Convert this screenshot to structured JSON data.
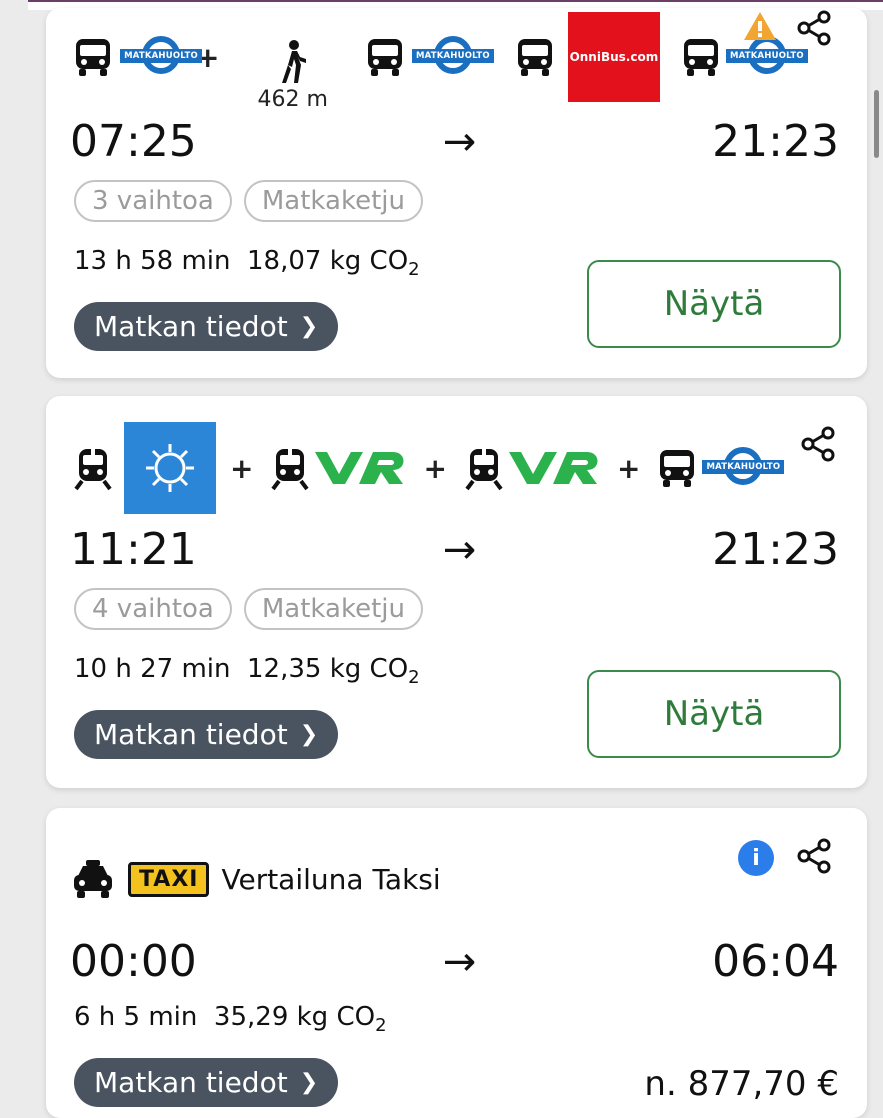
{
  "colors": {
    "accent_green": "#2e7b3c",
    "matkahuolto_blue": "#1a6fc0",
    "onnibus_red": "#e3111b",
    "vr_green": "#2bb24c",
    "warning": "#f2a531",
    "info_blue": "#2b7de9",
    "taxi_yellow": "#f4c21f"
  },
  "journeys": [
    {
      "icons": [
        "bus-icon",
        "matkahuolto-logo",
        "walk-icon",
        "bus-icon",
        "matkahuolto-logo",
        "bus-icon",
        "onnibus-logo",
        "bus-icon",
        "matkahuolto-logo",
        "warning-icon",
        "share-icon"
      ],
      "logo_text": "MATKAHUOLTO",
      "onnibus_text": "OnniBus.com",
      "walk_distance": "462 m",
      "departure": "07:25",
      "arrow": "→",
      "arrival": "21:23",
      "chips": [
        "3 vaihtoa",
        "Matkaketju"
      ],
      "duration": "13 h 58 min",
      "co2": "18,07 kg CO",
      "co2_sub": "2",
      "details_label": "Matkan tiedot",
      "show_label": "Näytä"
    },
    {
      "icons": [
        "train-icon",
        "weather-logo",
        "train-icon",
        "vr-logo",
        "train-icon",
        "vr-logo",
        "bus-icon",
        "matkahuolto-logo",
        "share-icon"
      ],
      "logo_text": "MATKAHUOLTO",
      "plus": "+",
      "departure": "11:21",
      "arrow": "→",
      "arrival": "21:23",
      "chips": [
        "4 vaihtoa",
        "Matkaketju"
      ],
      "duration": "10 h 27 min",
      "co2": "12,35 kg CO",
      "co2_sub": "2",
      "details_label": "Matkan tiedot",
      "show_label": "Näytä"
    },
    {
      "icons": [
        "taxi-car-icon",
        "info-icon",
        "share-icon"
      ],
      "taxi_badge": "TAXI",
      "label": "Vertailuna Taksi",
      "info_glyph": "i",
      "departure": "00:00",
      "arrow": "→",
      "arrival": "06:04",
      "duration": "6 h 5 min",
      "co2": "35,29 kg CO",
      "co2_sub": "2",
      "details_label": "Matkan tiedot",
      "price": "n. 877,70 €"
    }
  ]
}
